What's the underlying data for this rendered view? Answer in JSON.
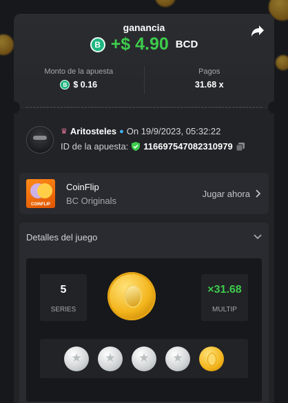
{
  "header": {
    "title": "ganancia",
    "amount": "+$ 4.90",
    "currency": "BCD",
    "currency_icon": "B"
  },
  "stats": {
    "wager_label": "Monto de la apuesta",
    "wager_value": "$ 0.16",
    "payout_label": "Pagos",
    "payout_value": "31.68 x"
  },
  "user": {
    "name": "Aritosteles",
    "date": "On 19/9/2023, 05:32:22",
    "bet_id_label": "ID de la apuesta:",
    "bet_id": "116697547082310979"
  },
  "game": {
    "name": "CoinFlip",
    "provider": "BC Originals",
    "thumb_label": "COINFLIP",
    "play_label": "Jugar ahora"
  },
  "details": {
    "title": "Detalles del juego",
    "series_value": "5",
    "series_label": "SERIES",
    "multip_value": "×31.68",
    "multip_label": "MULTIP",
    "coins": [
      "silver",
      "silver",
      "silver",
      "silver",
      "gold"
    ]
  },
  "colors": {
    "accent_green": "#3dcc4c",
    "bcd_green": "#1fb57f",
    "card_bg": "#222327"
  }
}
